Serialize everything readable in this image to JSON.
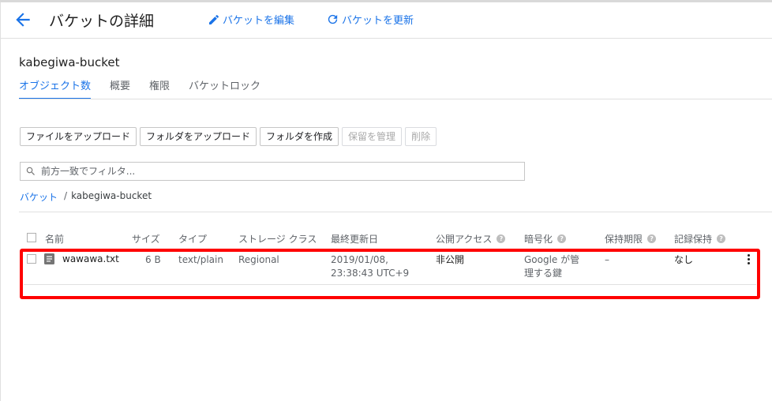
{
  "header": {
    "title": "バケットの詳細",
    "edit_label": "バケットを編集",
    "refresh_label": "バケットを更新"
  },
  "bucket_name": "kabegiwa-bucket",
  "tabs": [
    {
      "label": "オブジェクト数",
      "active": true
    },
    {
      "label": "概要",
      "active": false
    },
    {
      "label": "権限",
      "active": false
    },
    {
      "label": "バケットロック",
      "active": false
    }
  ],
  "toolbar": {
    "upload_files": "ファイルをアップロード",
    "upload_folder": "フォルダをアップロード",
    "create_folder": "フォルダを作成",
    "manage_holds": "保留を管理",
    "delete": "削除"
  },
  "filter": {
    "placeholder": "前方一致でフィルタ..."
  },
  "breadcrumb": {
    "root": "バケット",
    "separator": "/",
    "current": "kabegiwa-bucket"
  },
  "table": {
    "columns": {
      "name": "名前",
      "size": "サイズ",
      "type": "タイプ",
      "storage_class": "ストレージ クラス",
      "last_modified": "最終更新日",
      "public_access": "公開アクセス",
      "encryption": "暗号化",
      "retention_expiry": "保持期限",
      "retention_hold": "記録保持"
    },
    "rows": [
      {
        "name": "wawawa.txt",
        "size": "6 B",
        "type": "text/plain",
        "storage_class": "Regional",
        "last_modified_line1": "2019/01/08,",
        "last_modified_line2": "23:38:43 UTC+9",
        "public_access": "非公開",
        "encryption_line1": "Google が管",
        "encryption_line2": "理する鍵",
        "retention_expiry": "–",
        "retention_hold": "なし"
      }
    ]
  },
  "colors": {
    "accent": "#1a73e8",
    "highlight": "#ff0000"
  },
  "icons": {
    "back": "arrow-back-icon",
    "edit": "pencil-icon",
    "refresh": "refresh-icon",
    "search": "search-icon",
    "file": "file-icon",
    "more": "more-vert-icon",
    "help": "help-icon"
  }
}
